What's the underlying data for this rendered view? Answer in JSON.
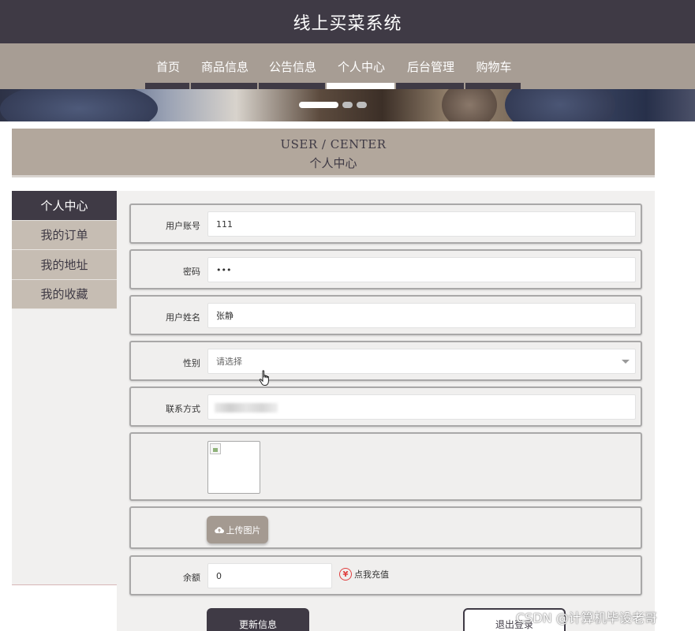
{
  "header": {
    "title": "线上买菜系统"
  },
  "nav": {
    "items": [
      {
        "label": "首页"
      },
      {
        "label": "商品信息"
      },
      {
        "label": "公告信息"
      },
      {
        "label": "个人中心"
      },
      {
        "label": "后台管理"
      },
      {
        "label": "购物车"
      }
    ],
    "active": "个人中心"
  },
  "section": {
    "title_en": "USER / CENTER",
    "title_cn": "个人中心"
  },
  "sidebar": {
    "items": [
      {
        "label": "个人中心"
      },
      {
        "label": "我的订单"
      },
      {
        "label": "我的地址"
      },
      {
        "label": "我的收藏"
      }
    ],
    "active": "个人中心"
  },
  "form": {
    "account": {
      "label": "用户账号",
      "value": "111"
    },
    "password": {
      "label": "密码",
      "value": "•••"
    },
    "name": {
      "label": "用户姓名",
      "value": "张静"
    },
    "gender": {
      "label": "性别",
      "placeholder": "请选择"
    },
    "contact": {
      "label": "联系方式"
    },
    "upload": {
      "label": "上传图片"
    },
    "balance": {
      "label": "余额",
      "value": "0"
    },
    "recharge": {
      "label": "点我充值",
      "symbol": "¥"
    }
  },
  "actions": {
    "update": "更新信息",
    "logout": "退出登录"
  },
  "watermark": "CSDN @计算机毕设老哥",
  "colors": {
    "primary": "#3f3a45",
    "accent": "#a79d94",
    "panel": "#b2a79c"
  }
}
